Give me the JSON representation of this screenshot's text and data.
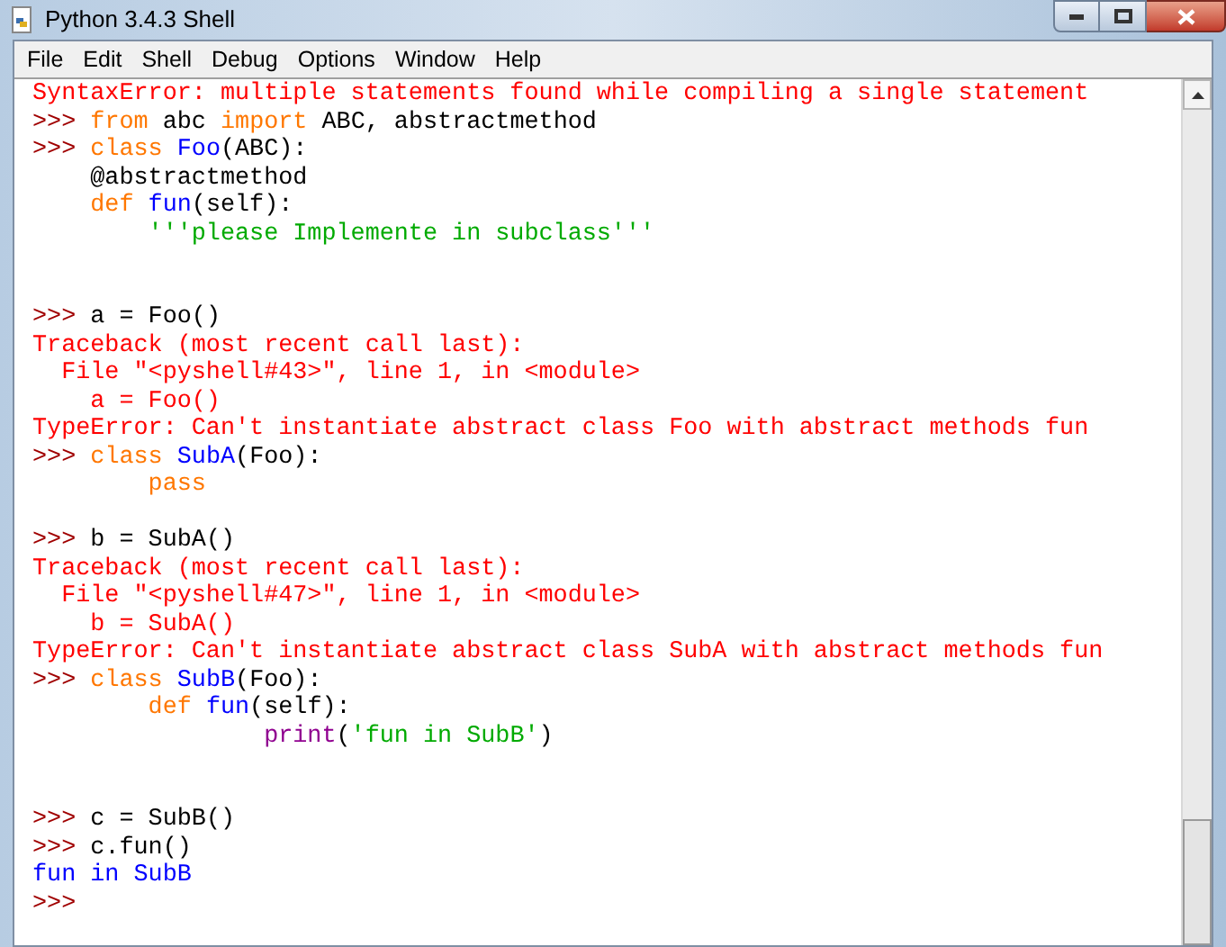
{
  "window": {
    "title": "Python 3.4.3 Shell"
  },
  "menu": [
    "File",
    "Edit",
    "Shell",
    "Debug",
    "Options",
    "Window",
    "Help"
  ],
  "lines": [
    {
      "kind": "code",
      "segments": [
        {
          "kind": "error",
          "text": "SyntaxError: multiple statements found while compiling a single statement"
        }
      ]
    },
    {
      "kind": "code",
      "segments": [
        {
          "kind": "prompt",
          "text": ">>> "
        },
        {
          "kind": "keyword",
          "text": "from"
        },
        {
          "kind": "plain",
          "text": " abc "
        },
        {
          "kind": "keyword",
          "text": "import"
        },
        {
          "kind": "plain",
          "text": " ABC, abstractmethod"
        }
      ]
    },
    {
      "kind": "code",
      "segments": [
        {
          "kind": "prompt",
          "text": ">>> "
        },
        {
          "kind": "keyword",
          "text": "class "
        },
        {
          "kind": "name",
          "text": "Foo"
        },
        {
          "kind": "plain",
          "text": "(ABC):"
        }
      ]
    },
    {
      "kind": "code",
      "segments": [
        {
          "kind": "plain",
          "text": "    @abstractmethod"
        }
      ]
    },
    {
      "kind": "code",
      "segments": [
        {
          "kind": "keyword",
          "text": "    def "
        },
        {
          "kind": "name",
          "text": "fun"
        },
        {
          "kind": "plain",
          "text": "(self):"
        }
      ]
    },
    {
      "kind": "code",
      "segments": [
        {
          "kind": "string",
          "text": "        '''please Implemente in subclass'''"
        }
      ]
    },
    {
      "kind": "blank"
    },
    {
      "kind": "blank"
    },
    {
      "kind": "code",
      "segments": [
        {
          "kind": "prompt",
          "text": ">>> "
        },
        {
          "kind": "plain",
          "text": "a = Foo()"
        }
      ]
    },
    {
      "kind": "code",
      "segments": [
        {
          "kind": "error",
          "text": "Traceback (most recent call last):"
        }
      ]
    },
    {
      "kind": "code",
      "segments": [
        {
          "kind": "error",
          "text": "  File \"<pyshell#43>\", line 1, in <module>"
        }
      ]
    },
    {
      "kind": "code",
      "segments": [
        {
          "kind": "error",
          "text": "    a = Foo()"
        }
      ]
    },
    {
      "kind": "code",
      "segments": [
        {
          "kind": "error",
          "text": "TypeError: Can't instantiate abstract class Foo with abstract methods fun"
        }
      ]
    },
    {
      "kind": "code",
      "segments": [
        {
          "kind": "prompt",
          "text": ">>> "
        },
        {
          "kind": "keyword",
          "text": "class "
        },
        {
          "kind": "name",
          "text": "SubA"
        },
        {
          "kind": "plain",
          "text": "(Foo):"
        }
      ]
    },
    {
      "kind": "code",
      "segments": [
        {
          "kind": "keyword",
          "text": "        pass"
        }
      ]
    },
    {
      "kind": "blank"
    },
    {
      "kind": "code",
      "segments": [
        {
          "kind": "prompt",
          "text": ">>> "
        },
        {
          "kind": "plain",
          "text": "b = SubA()"
        }
      ]
    },
    {
      "kind": "code",
      "segments": [
        {
          "kind": "error",
          "text": "Traceback (most recent call last):"
        }
      ]
    },
    {
      "kind": "code",
      "segments": [
        {
          "kind": "error",
          "text": "  File \"<pyshell#47>\", line 1, in <module>"
        }
      ]
    },
    {
      "kind": "code",
      "segments": [
        {
          "kind": "error",
          "text": "    b = SubA()"
        }
      ]
    },
    {
      "kind": "code",
      "segments": [
        {
          "kind": "error",
          "text": "TypeError: Can't instantiate abstract class SubA with abstract methods fun"
        }
      ]
    },
    {
      "kind": "code",
      "segments": [
        {
          "kind": "prompt",
          "text": ">>> "
        },
        {
          "kind": "keyword",
          "text": "class "
        },
        {
          "kind": "name",
          "text": "SubB"
        },
        {
          "kind": "plain",
          "text": "(Foo):"
        }
      ]
    },
    {
      "kind": "code",
      "segments": [
        {
          "kind": "keyword",
          "text": "        def "
        },
        {
          "kind": "name",
          "text": "fun"
        },
        {
          "kind": "plain",
          "text": "(self):"
        }
      ]
    },
    {
      "kind": "code",
      "segments": [
        {
          "kind": "builtin",
          "text": "                print"
        },
        {
          "kind": "plain",
          "text": "("
        },
        {
          "kind": "string",
          "text": "'fun in SubB'"
        },
        {
          "kind": "plain",
          "text": ")"
        }
      ]
    },
    {
      "kind": "blank"
    },
    {
      "kind": "blank"
    },
    {
      "kind": "code",
      "segments": [
        {
          "kind": "prompt",
          "text": ">>> "
        },
        {
          "kind": "plain",
          "text": "c = SubB()"
        }
      ]
    },
    {
      "kind": "code",
      "segments": [
        {
          "kind": "prompt",
          "text": ">>> "
        },
        {
          "kind": "plain",
          "text": "c.fun()"
        }
      ]
    },
    {
      "kind": "code",
      "segments": [
        {
          "kind": "output",
          "text": "fun in SubB"
        }
      ]
    },
    {
      "kind": "code",
      "segments": [
        {
          "kind": "prompt",
          "text": ">>>"
        }
      ]
    }
  ]
}
